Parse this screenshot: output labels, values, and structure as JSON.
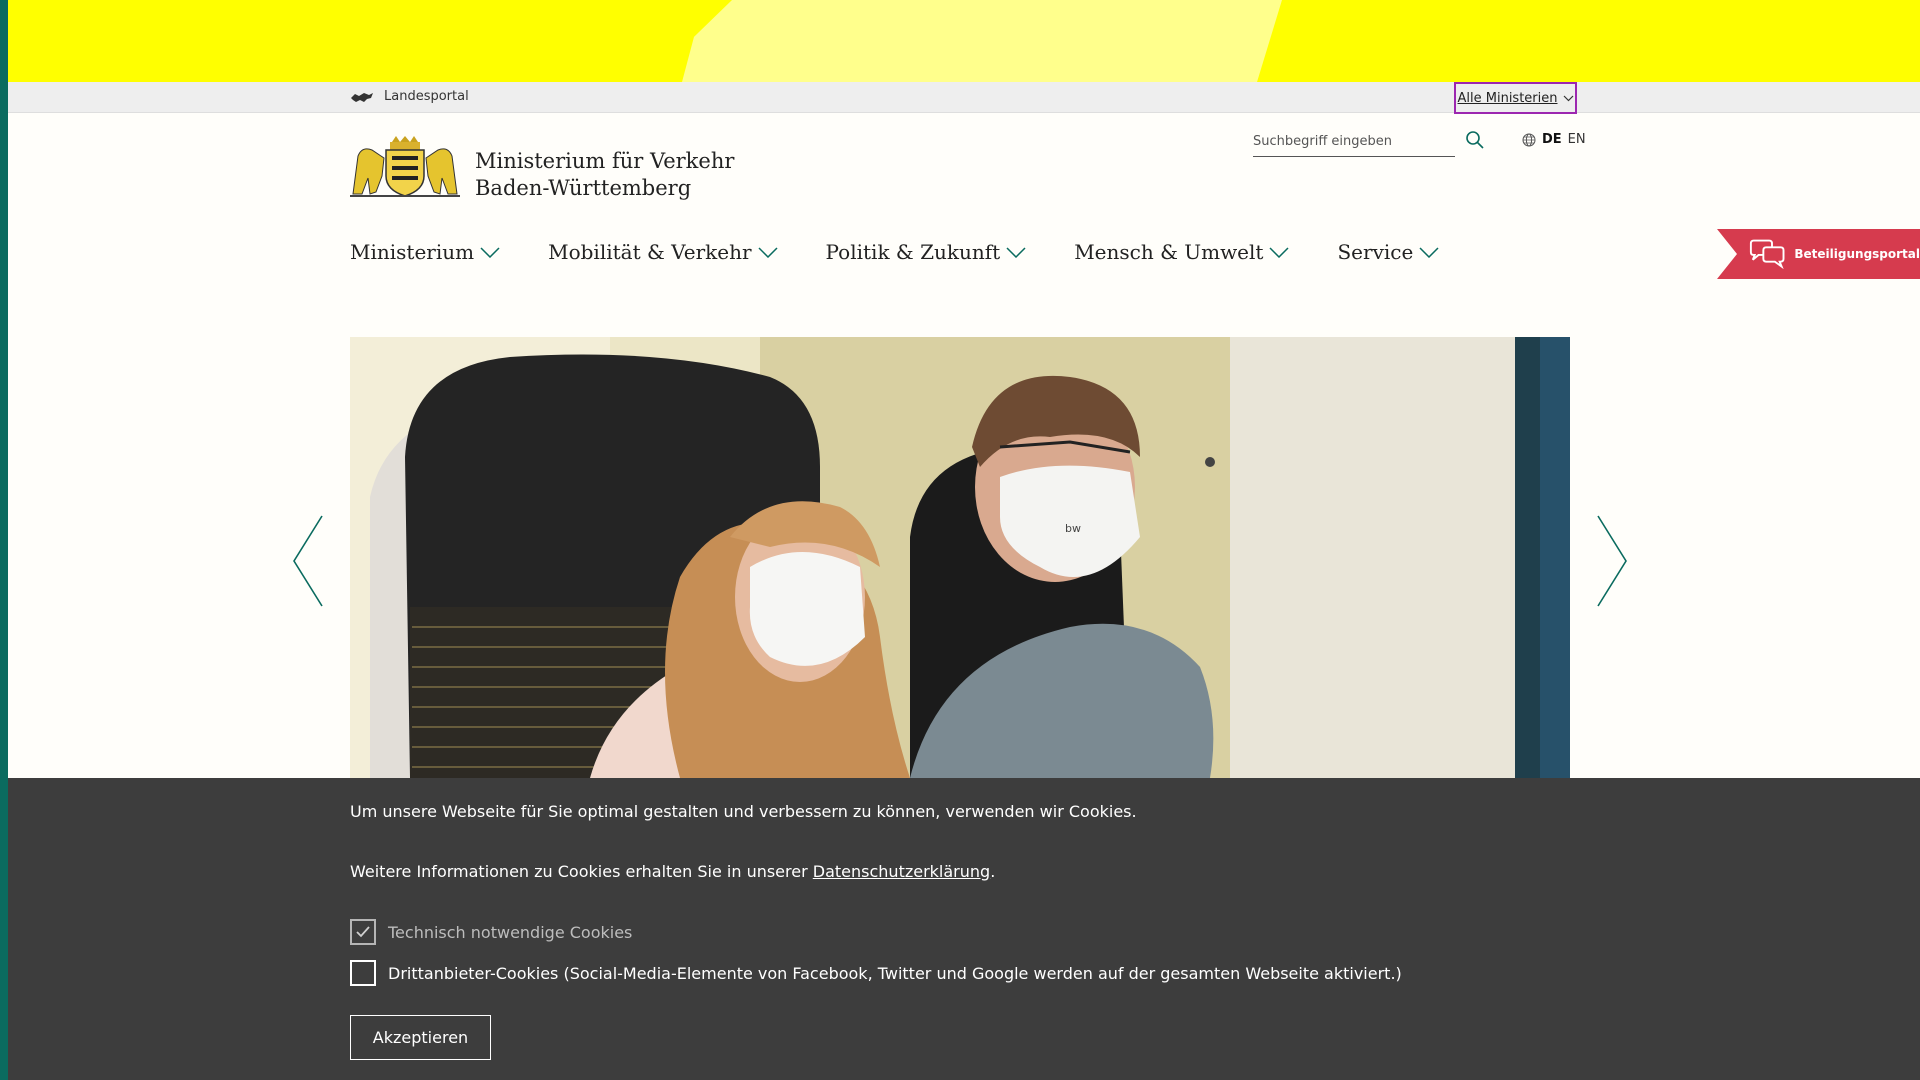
{
  "topbar": {
    "landesportal_label": "Landesportal",
    "ministries_label": "Alle Ministerien"
  },
  "header": {
    "ministry_line1": "Ministerium für Verkehr",
    "ministry_line2": "Baden-Württemberg",
    "search_placeholder": "Suchbegriff eingeben",
    "lang_de": "DE",
    "lang_en": "EN"
  },
  "nav": {
    "items": [
      {
        "label": "Ministerium"
      },
      {
        "label": "Mobilität & Verkehr"
      },
      {
        "label": "Politik & Zukunft"
      },
      {
        "label": "Mensch & Umwelt"
      },
      {
        "label": "Service"
      }
    ]
  },
  "beteiligung": {
    "label": "Beteiligungsportal"
  },
  "hero": {
    "mask_text": "bw"
  },
  "cookie": {
    "text1": "Um unsere Webseite für Sie optimal gestalten und verbessern zu können, verwenden wir Cookies.",
    "text2_prefix": "Weitere Informationen zu Cookies erhalten Sie in unserer ",
    "text2_link": "Datenschutzerklärung",
    "text2_suffix": ".",
    "option1": "Technisch notwendige Cookies",
    "option2": "Drittanbieter-Cookies (Social-Media-Elemente von Facebook, Twitter und Google werden auf der gesamten Webseite aktiviert.)",
    "accept_label": "Akzeptieren"
  },
  "colors": {
    "yellow": "#ffff00",
    "teal": "#0a6b5f",
    "beteiligung": "#d63b4e",
    "cookie_bg": "#3d3d3d",
    "focus": "#9c27b0"
  }
}
